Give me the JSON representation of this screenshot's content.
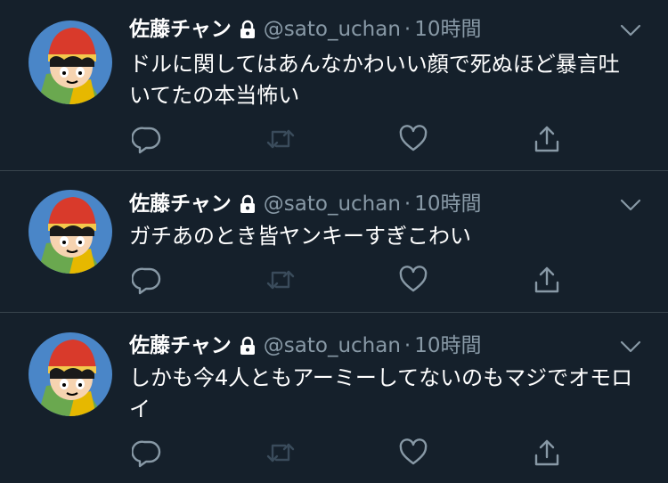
{
  "tweets": [
    {
      "name": "佐藤チャン",
      "handle": "@sato_uchan",
      "separator": "·",
      "time": "10時間",
      "text": "ドルに関してはあんなかわいい顔で死ぬほど暴言吐いてたの本当怖い"
    },
    {
      "name": "佐藤チャン",
      "handle": "@sato_uchan",
      "separator": "·",
      "time": "10時間",
      "text": "ガチあのとき皆ヤンキーすぎこわい"
    },
    {
      "name": "佐藤チャン",
      "handle": "@sato_uchan",
      "separator": "·",
      "time": "10時間",
      "text": "しかも今4人ともアーミーしてないのもマジでオモロイ"
    }
  ],
  "icons": {
    "reply": "reply-icon",
    "retweet": "retweet-icon",
    "like": "heart-icon",
    "share": "share-icon",
    "lock": "lock-icon",
    "caret": "chevron-down-icon"
  },
  "colors": {
    "background": "#15202b",
    "secondary_text": "#8899a6",
    "divider": "#38444d",
    "icon": "#8899a6"
  }
}
